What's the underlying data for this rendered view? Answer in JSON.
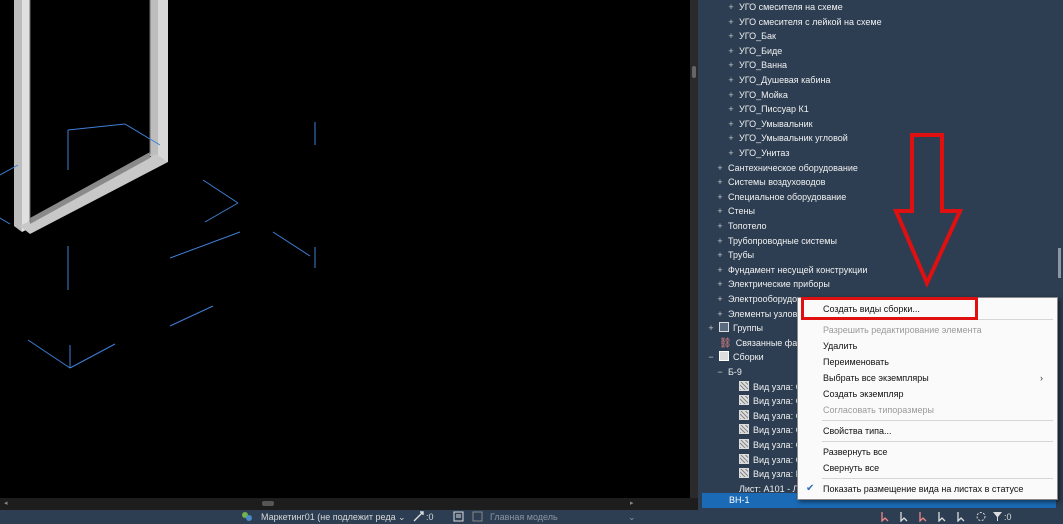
{
  "browser": {
    "rows": [
      {
        "label": "УГО смесителя на схеме",
        "level": 2,
        "exp": "+"
      },
      {
        "label": "УГО смесителя с лейкой на схеме",
        "level": 2,
        "exp": "+"
      },
      {
        "label": "УГО_Бак",
        "level": 2,
        "exp": "+"
      },
      {
        "label": "УГО_Биде",
        "level": 2,
        "exp": "+"
      },
      {
        "label": "УГО_Ванна",
        "level": 2,
        "exp": "+"
      },
      {
        "label": "УГО_Душевая кабина",
        "level": 2,
        "exp": "+"
      },
      {
        "label": "УГО_Мойка",
        "level": 2,
        "exp": "+"
      },
      {
        "label": "УГО_Писсуар К1",
        "level": 2,
        "exp": "+"
      },
      {
        "label": "УГО_Умывальник",
        "level": 2,
        "exp": "+"
      },
      {
        "label": "УГО_Умывальник угловой",
        "level": 2,
        "exp": "+"
      },
      {
        "label": "УГО_Унитаз",
        "level": 2,
        "exp": "+"
      },
      {
        "label": "Сантехническое оборудование",
        "level": 1,
        "exp": "+"
      },
      {
        "label": "Системы воздуховодов",
        "level": 1,
        "exp": "+"
      },
      {
        "label": "Специальное оборудование",
        "level": 1,
        "exp": "+"
      },
      {
        "label": "Стены",
        "level": 1,
        "exp": "+"
      },
      {
        "label": "Топотело",
        "level": 1,
        "exp": "+"
      },
      {
        "label": "Трубопроводные системы",
        "level": 1,
        "exp": "+"
      },
      {
        "label": "Трубы",
        "level": 1,
        "exp": "+"
      },
      {
        "label": "Фундамент несущей конструкции",
        "level": 1,
        "exp": "+"
      },
      {
        "label": "Электрические приборы",
        "level": 1,
        "exp": "+"
      },
      {
        "label": "Электрооборудова",
        "level": 1,
        "exp": "+"
      },
      {
        "label": "Элементы узлов",
        "level": 1,
        "exp": "+"
      },
      {
        "label": "Группы",
        "level": 0,
        "exp": "+",
        "icon": "group-icon"
      },
      {
        "label": "Связанные файлы",
        "level": 0,
        "exp": "",
        "icon": "link-icon"
      },
      {
        "label": "Сборки",
        "level": 0,
        "exp": "−",
        "icon": "assembly-icon"
      },
      {
        "label": "Б-9",
        "level": 1,
        "exp": "−"
      },
      {
        "label": "Вид узла: С",
        "level": 2,
        "exp": "",
        "icon": "view-icon"
      },
      {
        "label": "Вид узла: С",
        "level": 2,
        "exp": "",
        "icon": "view-icon"
      },
      {
        "label": "Вид узла: С",
        "level": 2,
        "exp": "",
        "icon": "view-icon"
      },
      {
        "label": "Вид узла: С",
        "level": 2,
        "exp": "",
        "icon": "view-icon"
      },
      {
        "label": "Вид узла: С",
        "level": 2,
        "exp": "",
        "icon": "view-icon"
      },
      {
        "label": "Вид узла: С",
        "level": 2,
        "exp": "",
        "icon": "view-icon"
      },
      {
        "label": "Вид узла: Г",
        "level": 2,
        "exp": "",
        "icon": "view-icon"
      },
      {
        "label": "Лист: А101 - Л",
        "level": 2,
        "exp": ""
      }
    ],
    "selected": "ВН-1"
  },
  "context_menu": {
    "items": [
      {
        "label": "Создать виды сборки...",
        "enabled": true
      },
      {
        "label": "Разрешить редактирование элемента",
        "enabled": false
      },
      {
        "label": "Удалить",
        "enabled": true
      },
      {
        "label": "Переименовать",
        "enabled": true
      },
      {
        "label": "Выбрать все экземпляры",
        "enabled": true,
        "submenu": "›"
      },
      {
        "label": "Создать экземпляр",
        "enabled": true
      },
      {
        "label": "Согласовать типоразмеры",
        "enabled": false
      },
      {
        "label": "Свойства типа...",
        "enabled": true
      },
      {
        "label": "Развернуть все",
        "enabled": true
      },
      {
        "label": "Свернуть все",
        "enabled": true
      },
      {
        "label": "Показать размещение вида на листах в статусе",
        "enabled": true,
        "checked": true
      }
    ]
  },
  "status": {
    "workset": "Маркетинг01 (не подлежит реда",
    "workset_count": ":0",
    "design_option": "Главная модель",
    "filter_count": ":0"
  },
  "colors": {
    "canvas": "#000000",
    "browser_bg": "#2d3e52",
    "selection": "#1a6ab5",
    "highlight_red": "#e01010",
    "drawing_lines": "#3f7fd6"
  }
}
